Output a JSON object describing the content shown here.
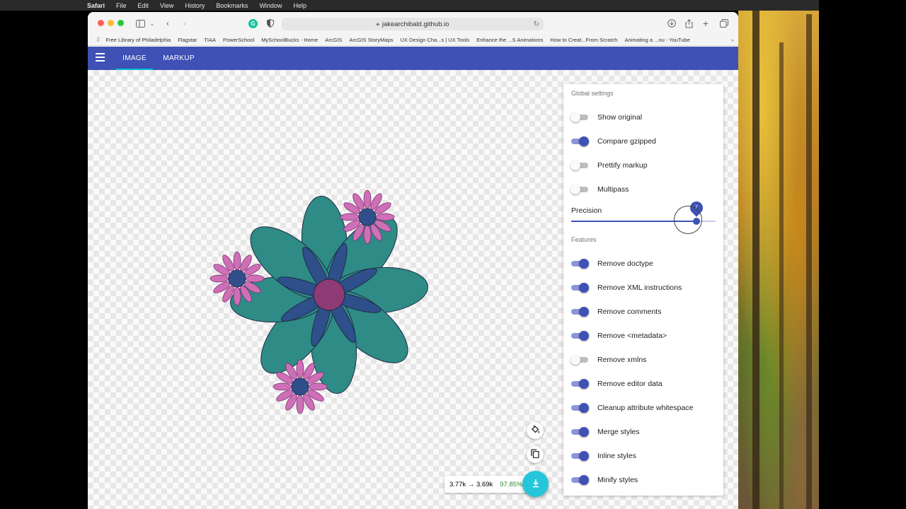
{
  "menubar": {
    "app": "Safari",
    "items": [
      "File",
      "Edit",
      "View",
      "History",
      "Bookmarks",
      "Window",
      "Help"
    ]
  },
  "browser": {
    "url": "jakearchibald.github.io",
    "bookmarks": [
      "Free Library of Philadelphia",
      "Flagstar",
      "TIAA",
      "PowerSchool",
      "MySchoolBucks - Home",
      "ArcGIS",
      "ArcGIS StoryMaps",
      "UX Design Cha...s | UX Tools",
      "Enhance the ...S Animations",
      "How to Creat...From Scratch",
      "Animating a ...nu - YouTube"
    ]
  },
  "appbar": {
    "tabs": [
      {
        "label": "IMAGE",
        "active": true
      },
      {
        "label": "MARKUP",
        "active": false
      }
    ]
  },
  "settings": {
    "global_title": "Global settings",
    "global": [
      {
        "label": "Show original",
        "on": false
      },
      {
        "label": "Compare gzipped",
        "on": true
      },
      {
        "label": "Prettify markup",
        "on": false
      },
      {
        "label": "Multipass",
        "on": false
      }
    ],
    "precision_label": "Precision",
    "precision_value": "7",
    "precision_fraction": 0.87,
    "features_title": "Features",
    "features": [
      {
        "label": "Remove doctype",
        "on": true
      },
      {
        "label": "Remove XML instructions",
        "on": true
      },
      {
        "label": "Remove comments",
        "on": true
      },
      {
        "label": "Remove <metadata>",
        "on": true
      },
      {
        "label": "Remove xmlns",
        "on": false
      },
      {
        "label": "Remove editor data",
        "on": true
      },
      {
        "label": "Cleanup attribute whitespace",
        "on": true
      },
      {
        "label": "Merge styles",
        "on": true
      },
      {
        "label": "Inline styles",
        "on": true
      },
      {
        "label": "Minify styles",
        "on": true
      }
    ]
  },
  "results": {
    "sizes": "3.77k → 3.69k",
    "percent": "97.85%"
  },
  "colors": {
    "primary": "#3f51b5",
    "accent": "#26c6da",
    "petal_teal": "#2e8b85",
    "petal_navy": "#2f4f8a",
    "center_magenta": "#8e3a74",
    "small_petal_pink": "#cf6fb8"
  },
  "icons": {
    "download": "download-icon",
    "copy": "copy-icon",
    "paint": "paint-bucket-icon"
  }
}
